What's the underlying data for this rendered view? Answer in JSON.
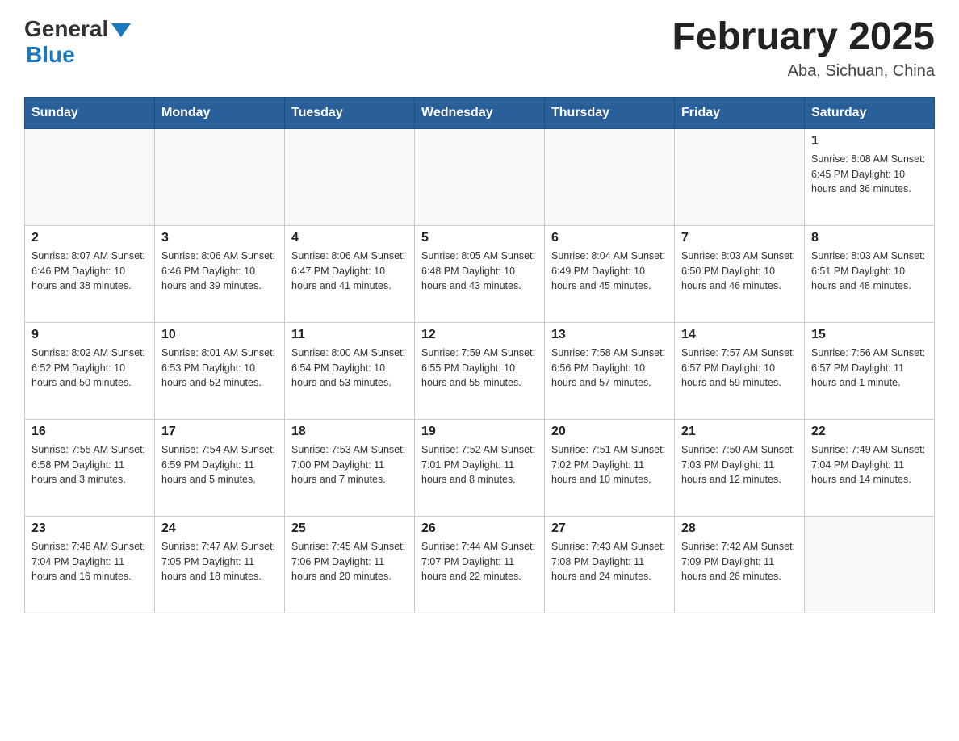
{
  "header": {
    "logo": {
      "text_general": "General",
      "triangle_alt": "blue triangle",
      "text_blue": "Blue"
    },
    "title": "February 2025",
    "location": "Aba, Sichuan, China"
  },
  "calendar": {
    "days_of_week": [
      "Sunday",
      "Monday",
      "Tuesday",
      "Wednesday",
      "Thursday",
      "Friday",
      "Saturday"
    ],
    "weeks": [
      [
        {
          "day": "",
          "info": ""
        },
        {
          "day": "",
          "info": ""
        },
        {
          "day": "",
          "info": ""
        },
        {
          "day": "",
          "info": ""
        },
        {
          "day": "",
          "info": ""
        },
        {
          "day": "",
          "info": ""
        },
        {
          "day": "1",
          "info": "Sunrise: 8:08 AM\nSunset: 6:45 PM\nDaylight: 10 hours and 36 minutes."
        }
      ],
      [
        {
          "day": "2",
          "info": "Sunrise: 8:07 AM\nSunset: 6:46 PM\nDaylight: 10 hours and 38 minutes."
        },
        {
          "day": "3",
          "info": "Sunrise: 8:06 AM\nSunset: 6:46 PM\nDaylight: 10 hours and 39 minutes."
        },
        {
          "day": "4",
          "info": "Sunrise: 8:06 AM\nSunset: 6:47 PM\nDaylight: 10 hours and 41 minutes."
        },
        {
          "day": "5",
          "info": "Sunrise: 8:05 AM\nSunset: 6:48 PM\nDaylight: 10 hours and 43 minutes."
        },
        {
          "day": "6",
          "info": "Sunrise: 8:04 AM\nSunset: 6:49 PM\nDaylight: 10 hours and 45 minutes."
        },
        {
          "day": "7",
          "info": "Sunrise: 8:03 AM\nSunset: 6:50 PM\nDaylight: 10 hours and 46 minutes."
        },
        {
          "day": "8",
          "info": "Sunrise: 8:03 AM\nSunset: 6:51 PM\nDaylight: 10 hours and 48 minutes."
        }
      ],
      [
        {
          "day": "9",
          "info": "Sunrise: 8:02 AM\nSunset: 6:52 PM\nDaylight: 10 hours and 50 minutes."
        },
        {
          "day": "10",
          "info": "Sunrise: 8:01 AM\nSunset: 6:53 PM\nDaylight: 10 hours and 52 minutes."
        },
        {
          "day": "11",
          "info": "Sunrise: 8:00 AM\nSunset: 6:54 PM\nDaylight: 10 hours and 53 minutes."
        },
        {
          "day": "12",
          "info": "Sunrise: 7:59 AM\nSunset: 6:55 PM\nDaylight: 10 hours and 55 minutes."
        },
        {
          "day": "13",
          "info": "Sunrise: 7:58 AM\nSunset: 6:56 PM\nDaylight: 10 hours and 57 minutes."
        },
        {
          "day": "14",
          "info": "Sunrise: 7:57 AM\nSunset: 6:57 PM\nDaylight: 10 hours and 59 minutes."
        },
        {
          "day": "15",
          "info": "Sunrise: 7:56 AM\nSunset: 6:57 PM\nDaylight: 11 hours and 1 minute."
        }
      ],
      [
        {
          "day": "16",
          "info": "Sunrise: 7:55 AM\nSunset: 6:58 PM\nDaylight: 11 hours and 3 minutes."
        },
        {
          "day": "17",
          "info": "Sunrise: 7:54 AM\nSunset: 6:59 PM\nDaylight: 11 hours and 5 minutes."
        },
        {
          "day": "18",
          "info": "Sunrise: 7:53 AM\nSunset: 7:00 PM\nDaylight: 11 hours and 7 minutes."
        },
        {
          "day": "19",
          "info": "Sunrise: 7:52 AM\nSunset: 7:01 PM\nDaylight: 11 hours and 8 minutes."
        },
        {
          "day": "20",
          "info": "Sunrise: 7:51 AM\nSunset: 7:02 PM\nDaylight: 11 hours and 10 minutes."
        },
        {
          "day": "21",
          "info": "Sunrise: 7:50 AM\nSunset: 7:03 PM\nDaylight: 11 hours and 12 minutes."
        },
        {
          "day": "22",
          "info": "Sunrise: 7:49 AM\nSunset: 7:04 PM\nDaylight: 11 hours and 14 minutes."
        }
      ],
      [
        {
          "day": "23",
          "info": "Sunrise: 7:48 AM\nSunset: 7:04 PM\nDaylight: 11 hours and 16 minutes."
        },
        {
          "day": "24",
          "info": "Sunrise: 7:47 AM\nSunset: 7:05 PM\nDaylight: 11 hours and 18 minutes."
        },
        {
          "day": "25",
          "info": "Sunrise: 7:45 AM\nSunset: 7:06 PM\nDaylight: 11 hours and 20 minutes."
        },
        {
          "day": "26",
          "info": "Sunrise: 7:44 AM\nSunset: 7:07 PM\nDaylight: 11 hours and 22 minutes."
        },
        {
          "day": "27",
          "info": "Sunrise: 7:43 AM\nSunset: 7:08 PM\nDaylight: 11 hours and 24 minutes."
        },
        {
          "day": "28",
          "info": "Sunrise: 7:42 AM\nSunset: 7:09 PM\nDaylight: 11 hours and 26 minutes."
        },
        {
          "day": "",
          "info": ""
        }
      ]
    ]
  }
}
